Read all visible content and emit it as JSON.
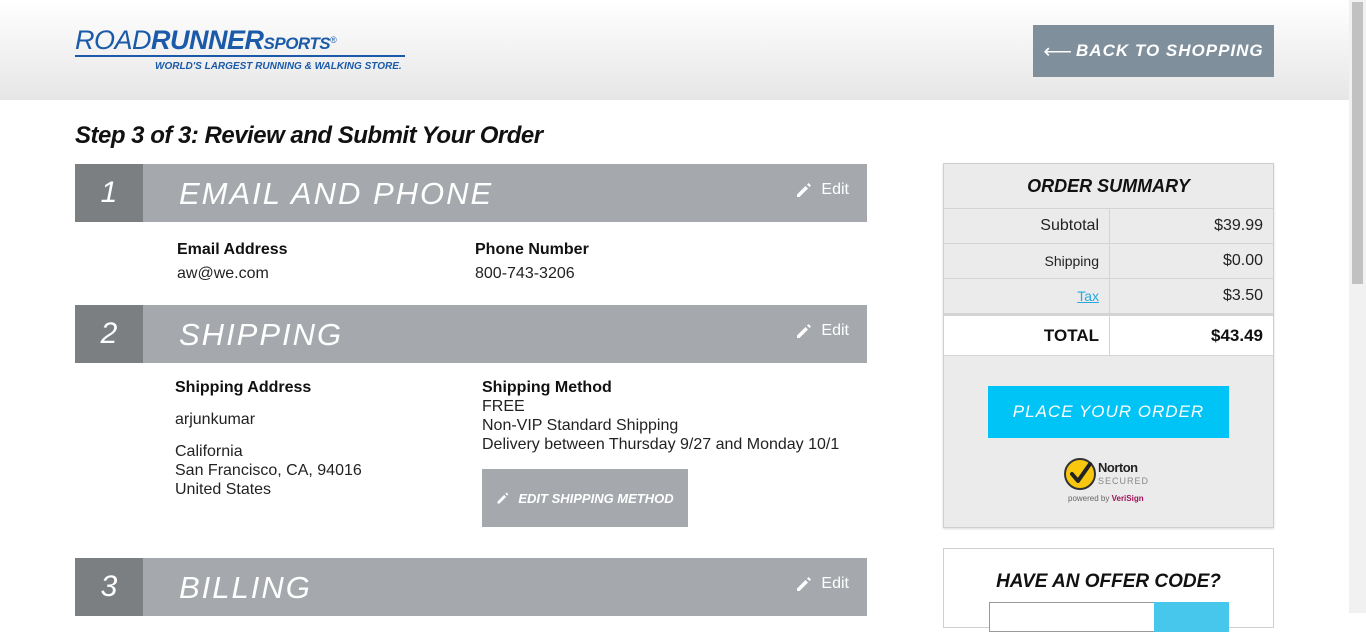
{
  "header": {
    "logo_road": "ROAD",
    "logo_runner": "RUNNER",
    "logo_sports": "SPORTS",
    "logo_reg": "®",
    "logo_tagline": "WORLD'S LARGEST RUNNING & WALKING STORE.",
    "back_arrow": "⟵",
    "back_label": "BACK TO SHOPPING"
  },
  "page_title": "Step 3 of 3: Review and Submit Your Order",
  "sections": [
    {
      "number": "1",
      "title": "EMAIL AND PHONE",
      "edit_label": "Edit"
    },
    {
      "number": "2",
      "title": "SHIPPING",
      "edit_label": "Edit"
    },
    {
      "number": "3",
      "title": "BILLING",
      "edit_label": "Edit"
    }
  ],
  "contact": {
    "email_label": "Email Address",
    "email_value": "aw@we.com",
    "phone_label": "Phone Number",
    "phone_value": "800-743-3206"
  },
  "shipping": {
    "address_label": "Shipping Address",
    "name": "arjunkumar",
    "state": "California",
    "city_line": "San Francisco, CA, 94016",
    "country": "United States",
    "method_label": "Shipping Method",
    "method_price": "FREE",
    "method_name": "Non-VIP Standard Shipping",
    "delivery": "Delivery between Thursday 9/27 and Monday 10/1",
    "edit_method_label": "EDIT SHIPPING METHOD"
  },
  "summary": {
    "title": "ORDER SUMMARY",
    "rows": [
      {
        "label": "Subtotal",
        "value": "$39.99"
      },
      {
        "label": "Shipping",
        "value": "$0.00"
      },
      {
        "label": "Tax",
        "value": "$3.50"
      }
    ],
    "total_label": "TOTAL",
    "total_value": "$43.49",
    "place_order_label": "PLACE YOUR ORDER",
    "norton_name": "Norton",
    "norton_secured": "SECURED",
    "norton_powered": "powered by",
    "norton_verisign": "VeriSign"
  },
  "offer": {
    "title": "HAVE AN OFFER CODE?"
  },
  "colors": {
    "brand_blue": "#1a5aa8",
    "cta_cyan": "#00c4f5",
    "section_gray": "#a5a9ad",
    "section_num_gray": "#7c7f82",
    "back_btn_gray": "#7f8f9c",
    "link_blue": "#2aa7dd"
  }
}
